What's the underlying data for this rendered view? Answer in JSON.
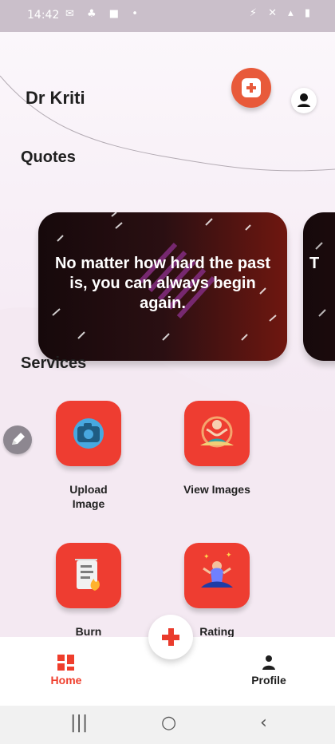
{
  "statusbar": {
    "time": "14:42",
    "left_icons": "✉ ♣ ■ •",
    "right_icons": "⚡ ✕ ▴ ▮"
  },
  "header": {
    "title": "Dr Kriti"
  },
  "sections": {
    "quotes": "Quotes",
    "services": "Services"
  },
  "quotes": [
    "No matter how hard the past is, you can always begin again.",
    "T"
  ],
  "services": [
    {
      "label": "Upload Image",
      "icon": "camera-icon"
    },
    {
      "label": "View Images",
      "icon": "meditation-icon"
    },
    {
      "label": "Burn",
      "icon": "document-icon"
    },
    {
      "label": "Rating",
      "icon": "person-lotus-icon"
    }
  ],
  "bottom_nav": {
    "home": "Home",
    "profile": "Profile"
  },
  "colors": {
    "accent": "#ee3d31",
    "quote_dark": "#16090b",
    "quote_red": "#6f1710"
  },
  "system_nav": {
    "recent": "|||",
    "home": "○",
    "back": "‹"
  }
}
